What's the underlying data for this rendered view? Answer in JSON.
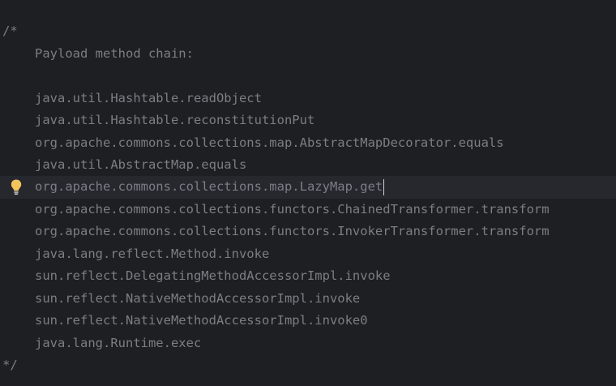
{
  "editor": {
    "comment_open": "/*",
    "heading": "Payload method chain:",
    "chain": [
      "java.util.Hashtable.readObject",
      "java.util.Hashtable.reconstitutionPut",
      "org.apache.commons.collections.map.AbstractMapDecorator.equals",
      "java.util.AbstractMap.equals",
      "org.apache.commons.collections.map.LazyMap.get",
      "org.apache.commons.collections.functors.ChainedTransformer.transform",
      "org.apache.commons.collections.functors.InvokerTransformer.transform",
      "java.lang.reflect.Method.invoke",
      "sun.reflect.DelegatingMethodAccessorImpl.invoke",
      "sun.reflect.NativeMethodAccessorImpl.invoke",
      "sun.reflect.NativeMethodAccessorImpl.invoke0",
      "java.lang.Runtime.exec"
    ],
    "comment_close": "*/",
    "current_line_index": 4,
    "gutter_icon": "lightbulb-icon",
    "colors": {
      "background": "#1e1f22",
      "current_line": "#26282e",
      "comment_text": "#7a7e85",
      "bulb": "#f2c55c"
    }
  }
}
